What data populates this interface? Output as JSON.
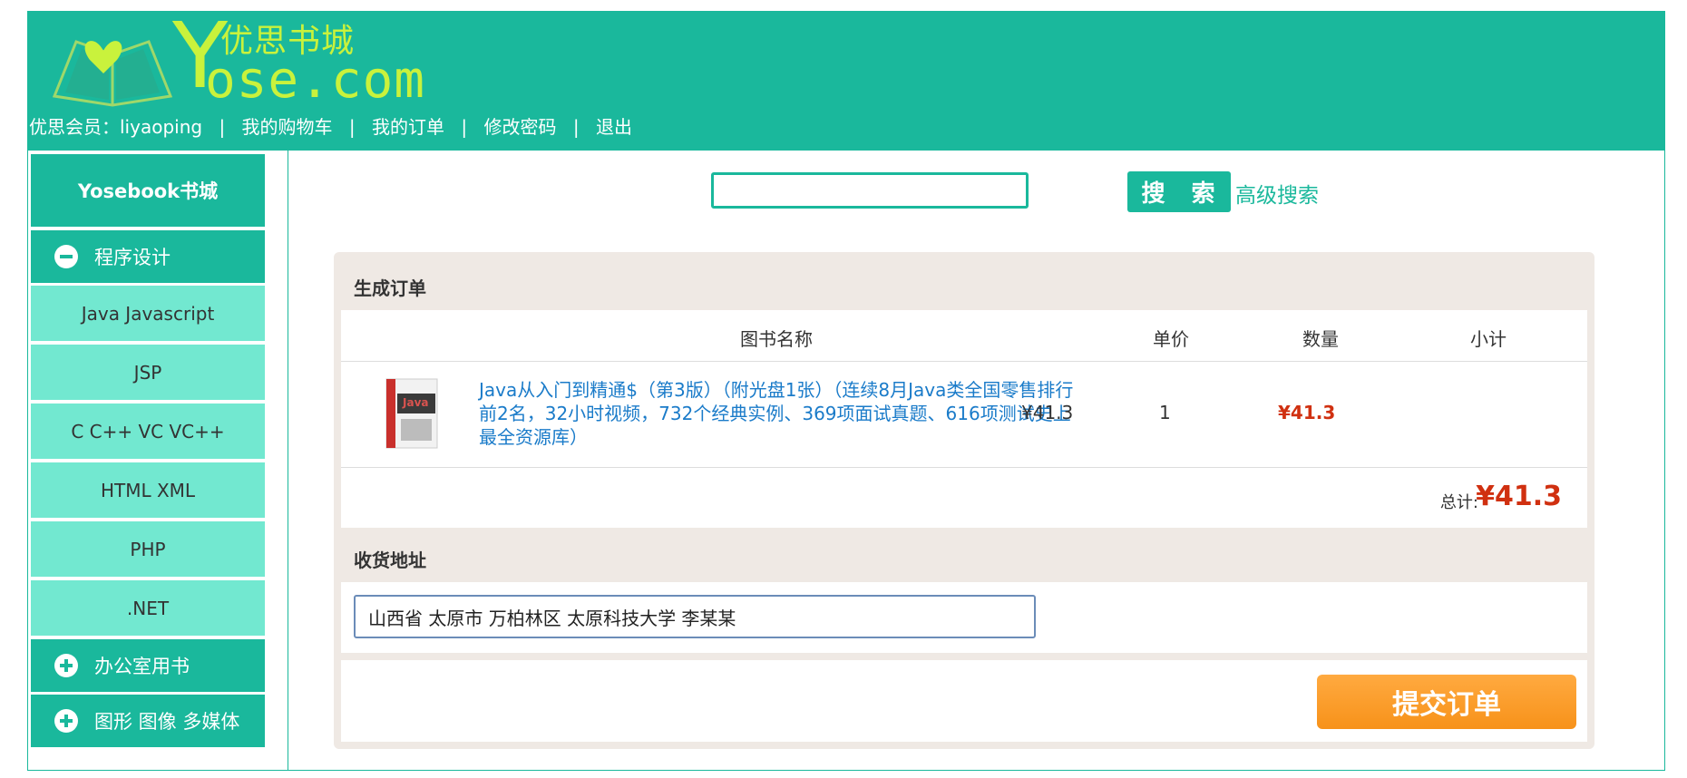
{
  "header": {
    "logo_cn": "优思书城",
    "logo_en": "ose.com",
    "logo_y": "Y",
    "nav": {
      "member": "优思会员：liyaoping",
      "cart": "我的购物车",
      "orders": "我的订单",
      "password": "修改密码",
      "logout": "退出",
      "separator": "|"
    }
  },
  "sidebar": {
    "title": "Yosebook书城",
    "categories": [
      {
        "label": "程序设计",
        "expanded": true,
        "items": [
          "Java Javascript",
          "JSP",
          "C C++ VC VC++",
          "HTML XML",
          "PHP",
          ".NET"
        ]
      },
      {
        "label": "办公室用书",
        "expanded": false
      },
      {
        "label": "图形 图像 多媒体",
        "expanded": false
      }
    ]
  },
  "search": {
    "value": "",
    "button_label": "搜 索",
    "advanced_label": "高级搜索"
  },
  "order": {
    "section_title": "生成订单",
    "columns": [
      "图书名称",
      "单价",
      "数量",
      "小计"
    ],
    "items": [
      {
        "title": "Java从入门到精通$（第3版）（附光盘1张）（连续8月Java类全国零售排行前2名，32小时视频，732个经典实例、369项面试真题、616项测试史上最全资源库）",
        "price": "¥41.3",
        "quantity": "1",
        "subtotal": "¥41.3",
        "cover_text": "Java"
      }
    ],
    "total_label": "总计:",
    "total_value": "¥41.3"
  },
  "address": {
    "section_title": "收货地址",
    "value": "山西省 太原市 万柏林区 太原科技大学  李某某"
  },
  "submit": {
    "label": "提交订单"
  },
  "colors": {
    "primary": "#1ab89c",
    "sub_item": "#72e8d0",
    "price_red": "#d03010",
    "link_blue": "#1a7bc9",
    "submit_orange": "#f7921a"
  }
}
